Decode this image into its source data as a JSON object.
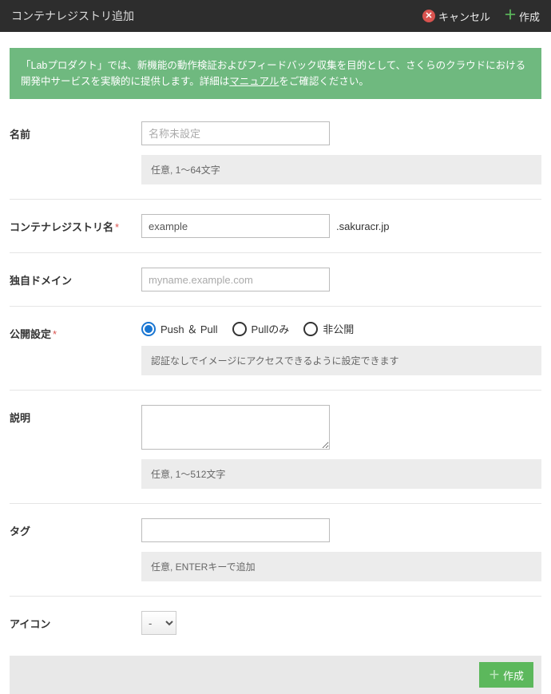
{
  "header": {
    "title": "コンテナレジストリ追加",
    "cancel": "キャンセル",
    "create": "作成"
  },
  "notice": {
    "text_before": "「Labプロダクト」では、新機能の動作検証およびフィードバック収集を目的として、さくらのクラウドにおける開発中サービスを実験的に提供します。詳細は",
    "link": "マニュアル",
    "text_after": "をご確認ください。"
  },
  "fields": {
    "name": {
      "label": "名前",
      "placeholder": "名称未設定",
      "hint": "任意, 1〜64文字"
    },
    "registry_name": {
      "label": "コンテナレジストリ名",
      "value": "example",
      "suffix": ".sakuracr.jp"
    },
    "custom_domain": {
      "label": "独自ドメイン",
      "placeholder": "myname.example.com"
    },
    "visibility": {
      "label": "公開設定",
      "options": [
        "Push ＆ Pull",
        "Pullのみ",
        "非公開"
      ],
      "selected": 0,
      "hint": "認証なしでイメージにアクセスできるように設定できます"
    },
    "description": {
      "label": "説明",
      "hint": "任意, 1〜512文字"
    },
    "tags": {
      "label": "タグ",
      "hint": "任意, ENTERキーで追加"
    },
    "icon": {
      "label": "アイコン",
      "selected": "-"
    }
  },
  "footer": {
    "create": "作成"
  }
}
